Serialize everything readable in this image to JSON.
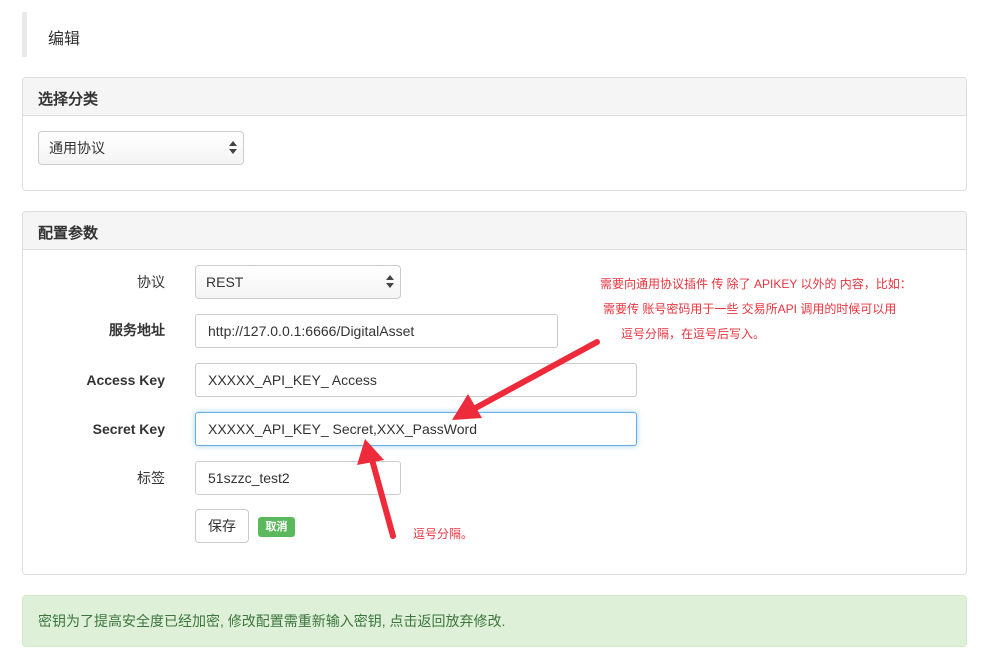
{
  "header": {
    "title": "编辑"
  },
  "category_panel": {
    "heading": "选择分类",
    "select_value": "通用协议"
  },
  "config_panel": {
    "heading": "配置参数",
    "fields": {
      "protocol": {
        "label": "协议",
        "value": "REST"
      },
      "service_url": {
        "label": "服务地址",
        "value": "http://127.0.0.1:6666/DigitalAsset"
      },
      "access_key": {
        "label": "Access Key",
        "value": "XXXXX_API_KEY_ Access"
      },
      "secret_key": {
        "label": "Secret Key",
        "value": "XXXXX_API_KEY_ Secret,XXX_PassWord"
      },
      "tag": {
        "label": "标签",
        "value": "51szzc_test2"
      }
    },
    "save_label": "保存",
    "cancel_label": "取消"
  },
  "annotations": {
    "note_line1": "需要向通用协议插件 传 除了 APIKEY 以外的 内容，比如：",
    "note_line2": "需要传 账号密码用于一些 交易所API 调用的时候可以用",
    "note_line3": "逗号分隔，在逗号后写入。",
    "note_comma": "逗号分隔。",
    "color": "#e8343f"
  },
  "alert": {
    "text": "密钥为了提高安全度已经加密, 修改配置需重新输入密钥, 点击返回放弃修改."
  }
}
